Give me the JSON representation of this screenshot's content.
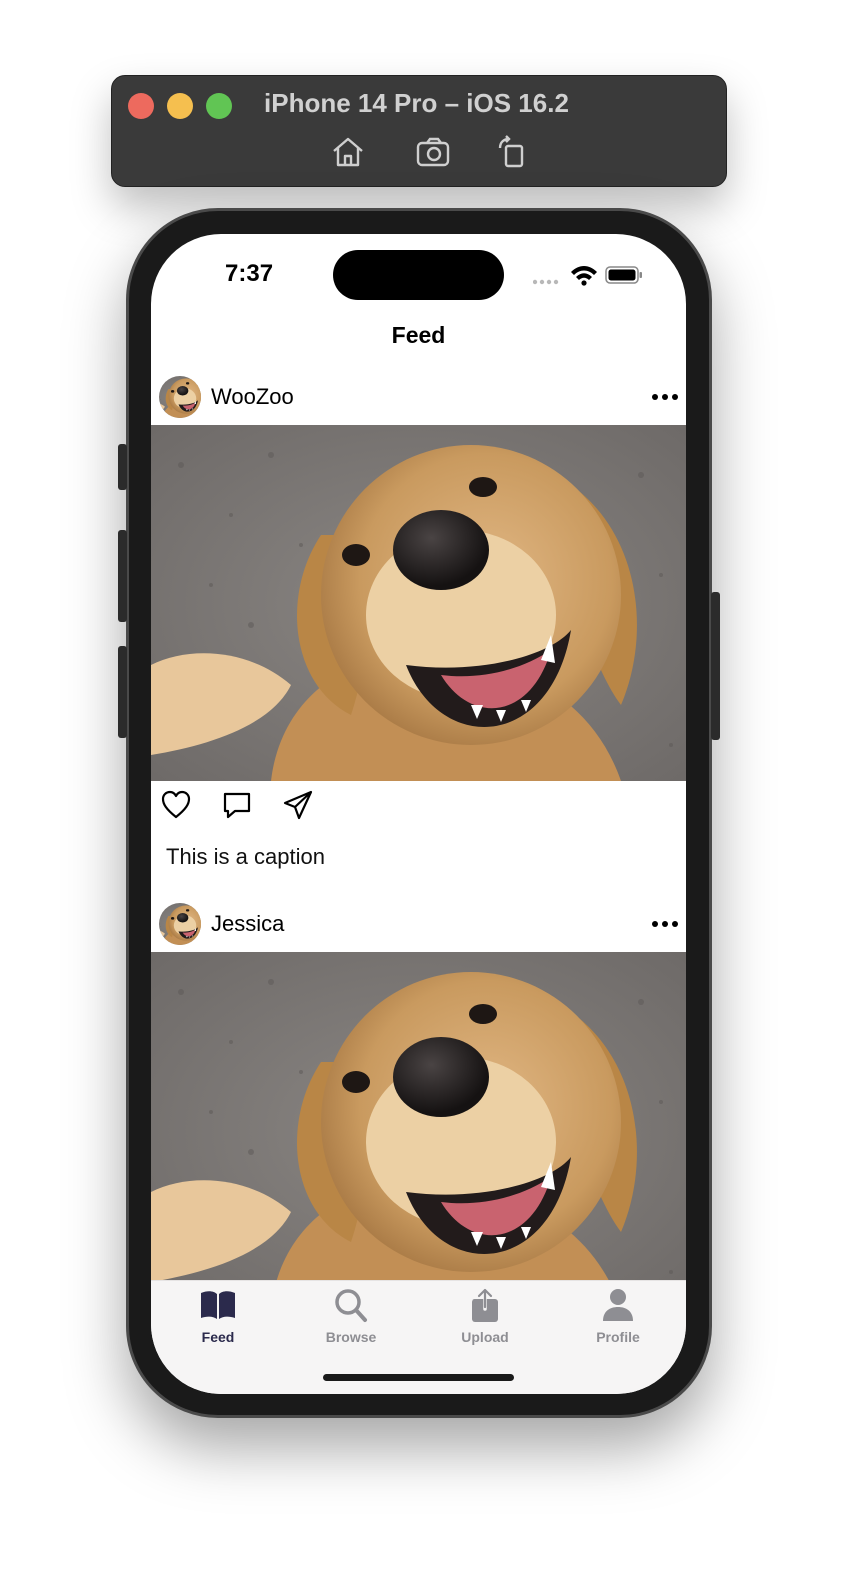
{
  "simulator": {
    "title": "iPhone 14 Pro – iOS 16.2",
    "tools": [
      "home-icon",
      "screenshot-icon",
      "rotate-icon"
    ]
  },
  "status_bar": {
    "time": "7:37",
    "icons": [
      "signal-icon",
      "wifi-icon",
      "battery-icon"
    ]
  },
  "nav": {
    "title": "Feed"
  },
  "posts": [
    {
      "username": "WooZoo",
      "caption": "This is a caption",
      "image": "golden-retriever-photo"
    },
    {
      "username": "Jessica",
      "image": "golden-retriever-photo"
    }
  ],
  "tabbar": {
    "tabs": [
      {
        "label": "Feed",
        "icon": "book-icon",
        "active": true
      },
      {
        "label": "Browse",
        "icon": "magnifier-icon",
        "active": false
      },
      {
        "label": "Upload",
        "icon": "upload-icon",
        "active": false
      },
      {
        "label": "Profile",
        "icon": "person-icon",
        "active": false
      }
    ]
  },
  "colors": {
    "accent": "#2b2a4c",
    "inactive": "#8e8e93"
  }
}
